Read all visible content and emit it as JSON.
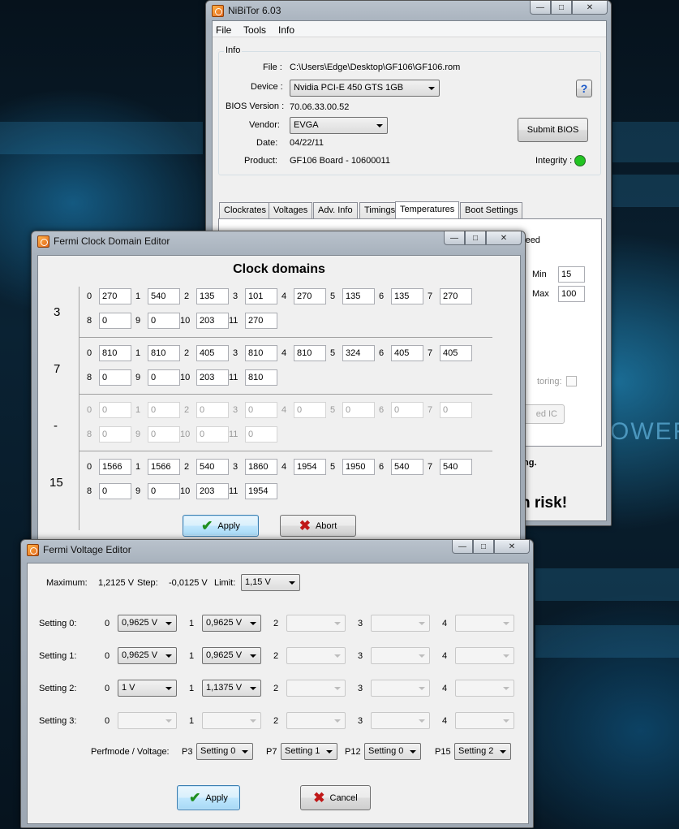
{
  "nibitor": {
    "title": "NiBiTor 6.03",
    "menu": [
      "File",
      "Tools",
      "Info"
    ],
    "group_info": "Info",
    "file_label": "File :",
    "file_value": "C:\\Users\\Edge\\Desktop\\GF106\\GF106.rom",
    "device_label": "Device :",
    "device_value": "Nvidia PCI-E 450 GTS 1GB",
    "bios_label": "BIOS Version :",
    "bios_value": "70.06.33.00.52",
    "vendor_label": "Vendor:",
    "vendor_value": "EVGA",
    "date_label": "Date:",
    "date_value": "04/22/11",
    "product_label": "Product:",
    "product_value": "GF106 Board - 10600011",
    "submit_bios": "Submit BIOS",
    "integrity_label": "Integrity :",
    "integrity_color": "#22c422",
    "help": "?",
    "tabs": [
      "Clockrates",
      "Voltages",
      "Adv. Info",
      "Timings",
      "Temperatures",
      "Boot Settings"
    ],
    "active_tab": "Temperatures",
    "fanspeed_label": "Fanspeed",
    "min_label": "Min",
    "min_value": "15",
    "max_label": "Max",
    "max_value": "100",
    "partial_monitoring": "toring:",
    "partial_ic": "ed IC",
    "partial_warning": "ing.",
    "partial_risk": "n risk!"
  },
  "clock_editor": {
    "title": "Fermi Clock Domain Editor",
    "heading": "Clock domains",
    "groups": [
      {
        "label": "3",
        "enabled": true,
        "values": [
          "270",
          "540",
          "135",
          "101",
          "270",
          "135",
          "135",
          "270",
          "0",
          "0",
          "203",
          "270"
        ]
      },
      {
        "label": "7",
        "enabled": true,
        "values": [
          "810",
          "810",
          "405",
          "810",
          "810",
          "324",
          "405",
          "405",
          "0",
          "0",
          "203",
          "810"
        ]
      },
      {
        "label": "-",
        "enabled": false,
        "values": [
          "0",
          "0",
          "0",
          "0",
          "0",
          "0",
          "0",
          "0",
          "0",
          "0",
          "0",
          "0"
        ]
      },
      {
        "label": "15",
        "enabled": true,
        "values": [
          "1566",
          "1566",
          "540",
          "1860",
          "1954",
          "1950",
          "540",
          "540",
          "0",
          "0",
          "203",
          "1954"
        ]
      }
    ],
    "indices": [
      "0",
      "1",
      "2",
      "3",
      "4",
      "5",
      "6",
      "7",
      "8",
      "9",
      "10",
      "11"
    ],
    "apply": "Apply",
    "abort": "Abort"
  },
  "voltage_editor": {
    "title": "Fermi Voltage Editor",
    "maximum_label": "Maximum:",
    "maximum_value": "1,2125 V",
    "step_label": "Step:",
    "step_value": "-0,0125 V",
    "limit_label": "Limit:",
    "limit_value": "1,15 V",
    "indices": [
      "0",
      "1",
      "2",
      "3",
      "4"
    ],
    "settings": [
      {
        "label": "Setting 0:",
        "values": [
          "0,9625 V",
          "0,9625 V",
          "",
          "",
          ""
        ]
      },
      {
        "label": "Setting 1:",
        "values": [
          "0,9625 V",
          "0,9625 V",
          "",
          "",
          ""
        ]
      },
      {
        "label": "Setting 2:",
        "values": [
          "1 V",
          "1,1375 V",
          "",
          "",
          ""
        ]
      },
      {
        "label": "Setting 3:",
        "values": [
          "",
          "",
          "",
          "",
          ""
        ]
      }
    ],
    "perfmode_label": "Perfmode / Voltage:",
    "perfmodes": [
      {
        "label": "P3",
        "value": "Setting 0"
      },
      {
        "label": "P7",
        "value": "Setting 1"
      },
      {
        "label": "P12",
        "value": "Setting 0"
      },
      {
        "label": "P15",
        "value": "Setting 2"
      }
    ],
    "apply": "Apply",
    "cancel": "Cancel"
  },
  "background": {
    "text": "OWER"
  }
}
